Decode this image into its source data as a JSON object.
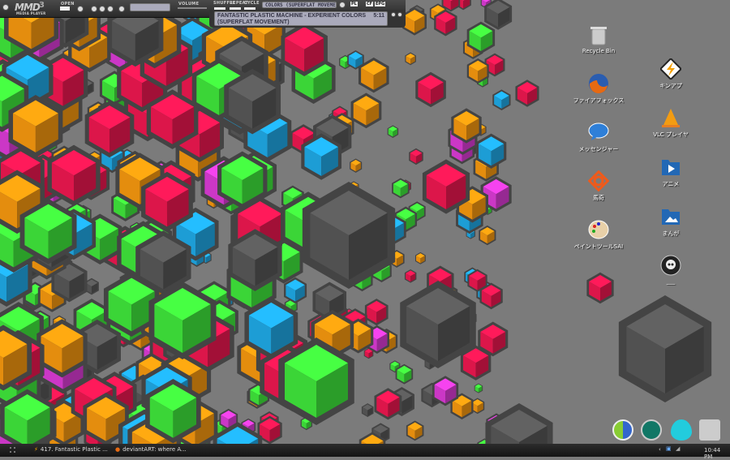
{
  "player": {
    "logo": "MMD",
    "subtitle": "MEDIA PLAYER",
    "badge": "3",
    "open_label": "OPEN",
    "volume_label": "VOLUME",
    "shuffle_label": "SHUFFLE",
    "repeat_label": "REPEAT",
    "cycle_label": "CYCLE",
    "title_short": "COLORS (SUPERFLAT MOVEMENT) 5:11",
    "track": "FANTASTIC PLASTIC MACHINE - EXPERIENT COLORS (SUPERFLAT MOVEMENT)",
    "track_time": "5:11",
    "buttons": [
      "PL",
      "CF",
      "EPG"
    ]
  },
  "desktop_icons": [
    {
      "label": "Recycle Bin",
      "icon": "recycle-bin-icon"
    },
    {
      "label": "ファイアフォックス",
      "icon": "firefox-icon"
    },
    {
      "label": "メッセンジャー",
      "icon": "messenger-icon"
    },
    {
      "label": "馬奇",
      "icon": "knot-icon"
    },
    {
      "label": "ペイントツールSAI",
      "icon": "palette-icon"
    },
    {
      "label": "キンアプ",
      "icon": "winamp-icon"
    },
    {
      "label": "VLC プレイヤ",
      "icon": "vlc-icon"
    },
    {
      "label": "アニメ",
      "icon": "video-folder-icon"
    },
    {
      "label": "まんが",
      "icon": "picture-folder-icon"
    },
    {
      "label": "___",
      "icon": "skull-icon"
    }
  ],
  "taskbar": {
    "tasks": [
      {
        "label": "417. Fantastic Plastic ...",
        "icon": "winamp-icon"
      },
      {
        "label": "deviantART: where A...",
        "icon": "firefox-icon"
      }
    ],
    "clock": "10:44 PM"
  },
  "colors": {
    "background": "#7b7b7b",
    "green": "#3ee03a",
    "orange": "#f0940f",
    "pink": "#e8174e",
    "blue": "#1fa5e0",
    "gray": "#555555",
    "magenta": "#d63ad0"
  }
}
